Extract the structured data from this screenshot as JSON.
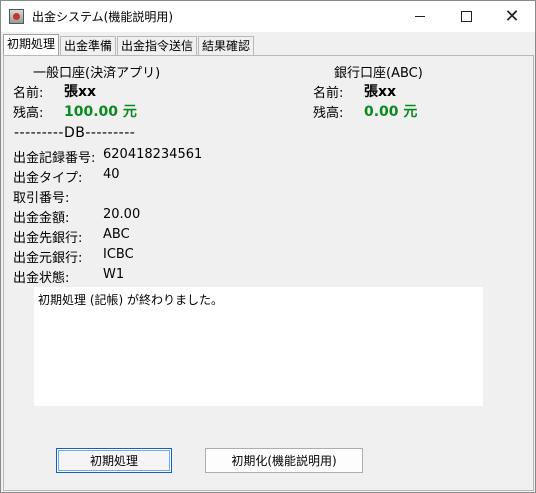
{
  "window": {
    "title": "出金システム(機能説明用)",
    "controls": {
      "minimize": "—",
      "maximize": "□",
      "close": "✕"
    }
  },
  "tabs": [
    {
      "label": "初期処理",
      "active": true
    },
    {
      "label": "出金準備",
      "active": false
    },
    {
      "label": "出金指令送信",
      "active": false
    },
    {
      "label": "結果確認",
      "active": false
    }
  ],
  "general_account": {
    "heading": "一般口座(決済アプリ)",
    "name_label": "名前:",
    "name_value": "張xx",
    "balance_label": "残高:",
    "balance_value": "100.00 元"
  },
  "bank_account": {
    "heading": "銀行口座(ABC)",
    "name_label": "名前:",
    "name_value": "張xx",
    "balance_label": "残高:",
    "balance_value": "0.00 元"
  },
  "db": {
    "separator": "---------DB---------",
    "fields": [
      {
        "label": "出金記録番号:",
        "value": "620418234561"
      },
      {
        "label": "出金タイプ:",
        "value": "40"
      },
      {
        "label": "取引番号:",
        "value": ""
      },
      {
        "label": "出金金額:",
        "value": "20.00"
      },
      {
        "label": "出金先銀行:",
        "value": "ABC"
      },
      {
        "label": "出金元銀行:",
        "value": "ICBC"
      },
      {
        "label": "出金状態:",
        "value": "W1"
      }
    ]
  },
  "log": {
    "text": "初期処理 (記帳) が終わりました。"
  },
  "buttons": {
    "initial_process": "初期処理",
    "initialize": "初期化(機能説明用)"
  }
}
